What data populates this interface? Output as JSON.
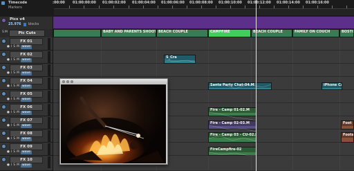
{
  "ruler": {
    "title": "Timecode",
    "subtitle": "Markers",
    "timecodes": [
      ":00:00",
      "01:00:00:00",
      "01:00:02:00",
      "01:00:04:00",
      "01:00:06:00",
      "01:00:08:00",
      "01:00:10:00",
      "01:00:12:00",
      "01:00:14:00",
      "01:00:16:00"
    ]
  },
  "picture_track": {
    "name": "Pics v4",
    "timecode": "25.976",
    "blocks_label": "blocks",
    "cuts_label": "Pic Cuts",
    "buttons": [
      "S",
      "M"
    ]
  },
  "track_buttons": [
    "●",
    "I",
    "S",
    "M",
    "wave"
  ],
  "tracks": [
    "FX 01",
    "FX 02",
    "FX 03",
    "FX 04",
    "FX 05",
    "FX 06",
    "FX 07",
    "FX 08",
    "FX 09",
    "FX 10"
  ],
  "pic_cuts": [
    {
      "label": "BABY AND PARENTS SHOOT",
      "selected": false
    },
    {
      "label": "BEACH COUPLE",
      "selected": false
    },
    {
      "label": "CAMPFIRE",
      "selected": true
    },
    {
      "label": "BEACH COUPLE",
      "selected": false
    },
    {
      "label": "FAMILY ON COUCH",
      "selected": false
    },
    {
      "label": "BOSTON",
      "selected": false
    }
  ],
  "clips": [
    {
      "label": "S_Cra",
      "color": "#2f7f8f"
    },
    {
      "label": "Santa Party Chat-04.M",
      "color": "#2f7f8f"
    },
    {
      "label": "iPhone Ca",
      "color": "#2f7f8f"
    },
    {
      "label": "Fire - Camp 01-02.M",
      "color": "#3d7f4c"
    },
    {
      "label": "Fire - Camp 02-03.M",
      "color": "#5a4f86"
    },
    {
      "label": "Fire - Camp 03 - CU-02.M",
      "color": "#3d7f4c"
    },
    {
      "label": "FireCampfire-02",
      "color": "#3d7f4c"
    },
    {
      "label": "Foot",
      "color": "#8a4f3a"
    },
    {
      "label": "Footstep",
      "color": "#8a4f3a"
    }
  ],
  "colors": {
    "picture_track": "#5b2f8a",
    "pic_cut": "#3b7a55",
    "pic_cut_selected": "#3fcf5a"
  },
  "video_window": {
    "content": "campfire-video-frame"
  }
}
